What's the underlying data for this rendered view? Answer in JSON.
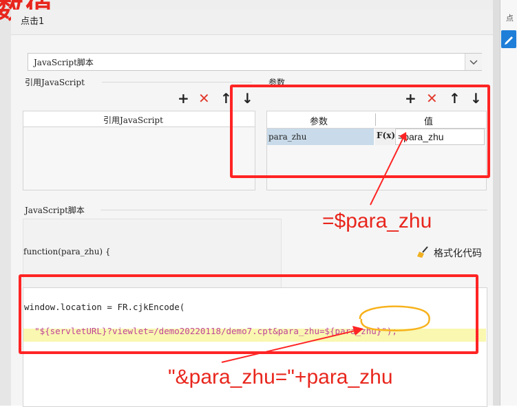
{
  "header": {
    "title_overlay": "数值",
    "dialog_title": "点击1",
    "side_tab": "点"
  },
  "script_type_select": {
    "value": "JavaScript脚本"
  },
  "ref_js": {
    "section_label": "引用JavaScript",
    "table_header": "引用JavaScript",
    "toolbar": {
      "add": "+",
      "delete": "✕",
      "up": "↑",
      "down": "↓"
    }
  },
  "params": {
    "section_label": "参数",
    "toolbar": {
      "add": "+",
      "delete": "✕",
      "up": "↑",
      "down": "↓"
    },
    "columns": [
      "参数",
      "值"
    ],
    "rows": [
      {
        "name": "para_zhu",
        "formula_icon": "F(x)",
        "value": "=para_zhu"
      }
    ]
  },
  "script": {
    "section_label": "JavaScript脚本",
    "signature": "function(para_zhu) {",
    "format_button": "格式化代码",
    "line1": "window.location = FR.cjkEncode(",
    "line2_prefix": "\"${servletURL}?viewlet=/demo20220118/demo7.cpt&para_zhu=",
    "line2_var": "${para_zhu}",
    "line2_suffix": "\");"
  },
  "annotations": {
    "top": "=$para_zhu",
    "bottom": "\"&para_zhu=\"+para_zhu"
  },
  "colors": {
    "accent_red": "#ff2424",
    "annot_red": "#e8261d",
    "highlight_yellow": "#f9f7b0",
    "param_row_bg": "#c9dbea",
    "circle_orange": "#f7b21c",
    "tab_blue": "#1f7ed8"
  }
}
